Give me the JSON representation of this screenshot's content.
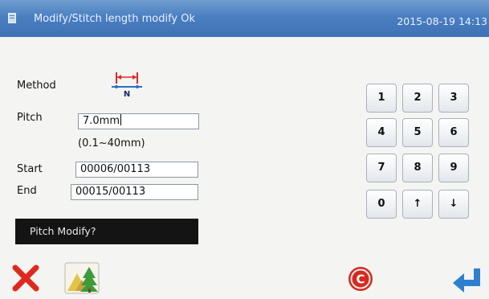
{
  "titlebar": {
    "title": "Modify/Stitch length modify  Ok",
    "datetime": "2015-08-19 14:13"
  },
  "form": {
    "method_label": "Method",
    "method_icon": "stitch-pitch-icon",
    "pitch_label": "Pitch",
    "pitch_value": "7.0mm",
    "pitch_range": "(0.1~40mm)",
    "start_label": "Start",
    "start_value": "00006/00113",
    "end_label": "End",
    "end_value": "00015/00113"
  },
  "message": "Pitch Modify?",
  "keypad": [
    "1",
    "2",
    "3",
    "4",
    "5",
    "6",
    "7",
    "8",
    "9",
    "0",
    "↑",
    "↓"
  ],
  "buttons": {
    "cancel_icon": "cancel-x-icon",
    "view_icon": "pattern-view-icon",
    "clear_icon": "clear-c-icon",
    "enter_icon": "enter-icon"
  },
  "colors": {
    "titlebar": "#4a7fc0",
    "message_bg": "#141414",
    "cancel": "#e0291e",
    "clear": "#d42a1f",
    "enter": "#2f7fd0"
  }
}
